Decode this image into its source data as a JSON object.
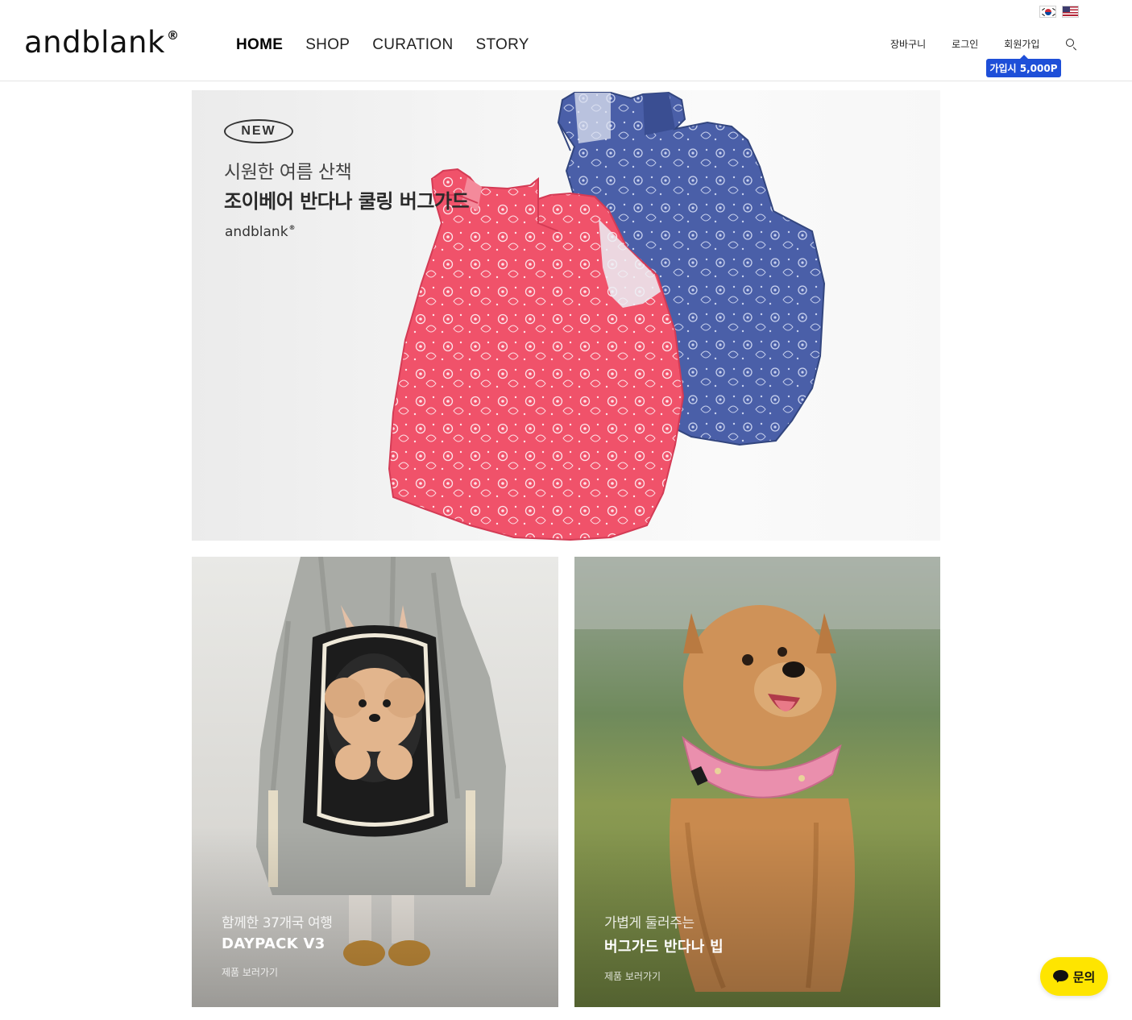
{
  "header": {
    "logo": "andblank",
    "logo_mark": "®",
    "nav": [
      "HOME",
      "SHOP",
      "CURATION",
      "STORY"
    ],
    "active_nav": "HOME",
    "util": {
      "cart": "장바구니",
      "login": "로그인",
      "join": "회원가입",
      "search_icon": "search-icon"
    },
    "join_badge": "가입시 5,000P",
    "languages": [
      "korean-flag-icon",
      "us-flag-icon"
    ]
  },
  "hero": {
    "badge": "NEW",
    "subtitle": "시원한 여름 산책",
    "title": "조이베어 반다나 쿨링 버그가드",
    "brand": "andblank",
    "brand_mark": "®"
  },
  "cards": [
    {
      "subtitle": "함께한 37개국 여행",
      "title": "DAYPACK V3",
      "link": "제품 보러가기"
    },
    {
      "subtitle": "가볍게 둘러주는",
      "title": "버그가드 반다나 빕",
      "link": "제품 보러가기"
    }
  ],
  "chat": {
    "label": "문의",
    "icon": "speech-bubble-icon"
  },
  "colors": {
    "join_badge": "#1e4fd8",
    "chat_button": "#fee500",
    "vest_pink": "#f0526a",
    "vest_blue": "#4a5fa8"
  }
}
